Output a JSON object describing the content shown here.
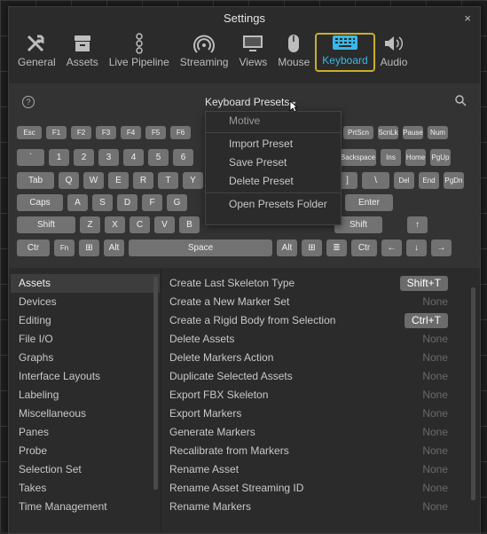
{
  "window": {
    "title": "Settings",
    "close_glyph": "×"
  },
  "tabs": [
    {
      "label": "General",
      "icon": "tools-icon"
    },
    {
      "label": "Assets",
      "icon": "box-icon"
    },
    {
      "label": "Live Pipeline",
      "icon": "pipeline-icon"
    },
    {
      "label": "Streaming",
      "icon": "streaming-icon"
    },
    {
      "label": "Views",
      "icon": "monitor-icon"
    },
    {
      "label": "Mouse",
      "icon": "mouse-icon"
    },
    {
      "label": "Keyboard",
      "icon": "keyboard-icon",
      "active": true
    },
    {
      "label": "Audio",
      "icon": "speaker-icon"
    }
  ],
  "keyboard": {
    "help_glyph": "?",
    "presets_label": "Keyboard Presets",
    "row_fn": [
      "Esc",
      "F1",
      "F2",
      "F3",
      "F4",
      "F5",
      "F6",
      "",
      "",
      "",
      "",
      "",
      "",
      "PrtScn",
      "ScnLk",
      "Pause",
      "Num"
    ],
    "row_num": [
      "`",
      "1",
      "2",
      "3",
      "4",
      "5",
      "6",
      "",
      "",
      "",
      "",
      "",
      "",
      "Backspace",
      "Ins",
      "Home",
      "PgUp"
    ],
    "row_tab": [
      "Tab",
      "Q",
      "W",
      "E",
      "R",
      "T",
      "Y",
      "",
      "",
      "",
      "",
      "[",
      "]",
      "\\",
      "Del",
      "End",
      "PgDn"
    ],
    "row_caps": [
      "Caps",
      "A",
      "S",
      "D",
      "F",
      "G",
      "",
      "",
      "",
      "",
      "",
      "",
      "Enter"
    ],
    "row_shift": [
      "Shift",
      "Z",
      "X",
      "C",
      "V",
      "B",
      "",
      "",
      "",
      "",
      "",
      "Shift",
      "↑"
    ],
    "row_ctrl": [
      "Ctr",
      "Fn",
      "⊞",
      "Alt",
      "Space",
      "Alt",
      "⊞",
      "≣",
      "Ctr",
      "←",
      "↓",
      "→"
    ]
  },
  "preset_menu": {
    "items": [
      {
        "label": "Motive",
        "disabled": true
      },
      {
        "label": "Import Preset"
      },
      {
        "label": "Save Preset"
      },
      {
        "label": "Delete Preset"
      },
      {
        "label": "Open Presets Folder"
      }
    ]
  },
  "categories": [
    "Assets",
    "Devices",
    "Editing",
    "File I/O",
    "Graphs",
    "Interface Layouts",
    "Labeling",
    "Miscellaneous",
    "Panes",
    "Probe",
    "Selection Set",
    "Takes",
    "Time Management"
  ],
  "selected_category": "Assets",
  "actions": [
    {
      "label": "Create Last Skeleton Type",
      "shortcut": "Shift+T",
      "set": true
    },
    {
      "label": "Create a New Marker Set",
      "shortcut": "None"
    },
    {
      "label": "Create a Rigid Body from Selection",
      "shortcut": "Ctrl+T",
      "set": true
    },
    {
      "label": "Delete Assets",
      "shortcut": "None"
    },
    {
      "label": "Delete Markers Action",
      "shortcut": "None"
    },
    {
      "label": "Duplicate Selected Assets",
      "shortcut": "None"
    },
    {
      "label": "Export FBX Skeleton",
      "shortcut": "None"
    },
    {
      "label": "Export Markers",
      "shortcut": "None"
    },
    {
      "label": "Generate Markers",
      "shortcut": "None"
    },
    {
      "label": "Recalibrate from Markers",
      "shortcut": "None"
    },
    {
      "label": "Rename Asset",
      "shortcut": "None"
    },
    {
      "label": "Rename Asset Streaming ID",
      "shortcut": "None"
    },
    {
      "label": "Rename Markers",
      "shortcut": "None"
    }
  ],
  "colors": {
    "accent": "#39b8e8",
    "active_border": "#c8b02a",
    "key": "#727272"
  }
}
